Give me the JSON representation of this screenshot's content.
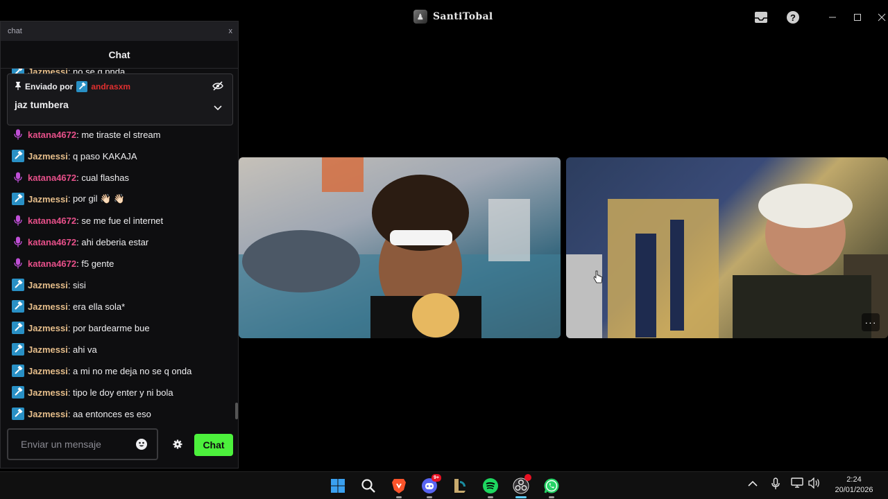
{
  "window": {
    "title": "SantiTobal"
  },
  "popup": {
    "title": "chat",
    "close": "x"
  },
  "chat": {
    "header": "Chat",
    "pinned": {
      "label": "Enviado por",
      "pinner": "andrasxm",
      "message": "jaz tumbera"
    },
    "partial_top": {
      "user": "Jazmessi",
      "text": ": no se q pnda"
    },
    "messages": [
      {
        "user": "katana4672",
        "text": ": me tiraste el stream",
        "badge": "mic-icon"
      },
      {
        "user": "Jazmessi",
        "text": ": q paso KAKAJA",
        "badge": "hammer-icon"
      },
      {
        "user": "katana4672",
        "text": ": cual flashas",
        "badge": "mic-icon"
      },
      {
        "user": "Jazmessi",
        "text": ": por gil 👋🏻 👋🏻",
        "badge": "hammer-icon"
      },
      {
        "user": "katana4672",
        "text": ": se me fue el internet",
        "badge": "mic-icon"
      },
      {
        "user": "katana4672",
        "text": ": ahi deberia estar",
        "badge": "mic-icon"
      },
      {
        "user": "katana4672",
        "text": ": f5 gente",
        "badge": "mic-icon"
      },
      {
        "user": "Jazmessi",
        "text": ": sisi",
        "badge": "hammer-icon"
      },
      {
        "user": "Jazmessi",
        "text": ": era ella sola*",
        "badge": "hammer-icon"
      },
      {
        "user": "Jazmessi",
        "text": ": por bardearme bue",
        "badge": "hammer-icon"
      },
      {
        "user": "Jazmessi",
        "text": ": ahi va",
        "badge": "hammer-icon"
      },
      {
        "user": "Jazmessi",
        "text": ": a mi no me deja no se q onda",
        "badge": "hammer-icon"
      },
      {
        "user": "Jazmessi",
        "text": ": tipo le doy enter y ni bola",
        "badge": "hammer-icon"
      },
      {
        "user": "Jazmessi",
        "text": ": aa entonces es eso",
        "badge": "hammer-icon"
      }
    ],
    "input_placeholder": "Enviar un mensaje",
    "send_label": "Chat",
    "colors": {
      "send_button": "#4cf13c",
      "jazmessi": "#e5bd8a",
      "katana": "#e7508a",
      "pinner": "#e02f2f"
    }
  },
  "taskbar": {
    "apps": [
      "windows-start-icon",
      "search-icon",
      "brave-icon",
      "discord-icon",
      "league-of-legends-icon",
      "spotify-icon",
      "obs-icon",
      "whatsapp-icon"
    ],
    "discord_badge": "9+",
    "time": "2:24",
    "date": "20/01/2026"
  }
}
